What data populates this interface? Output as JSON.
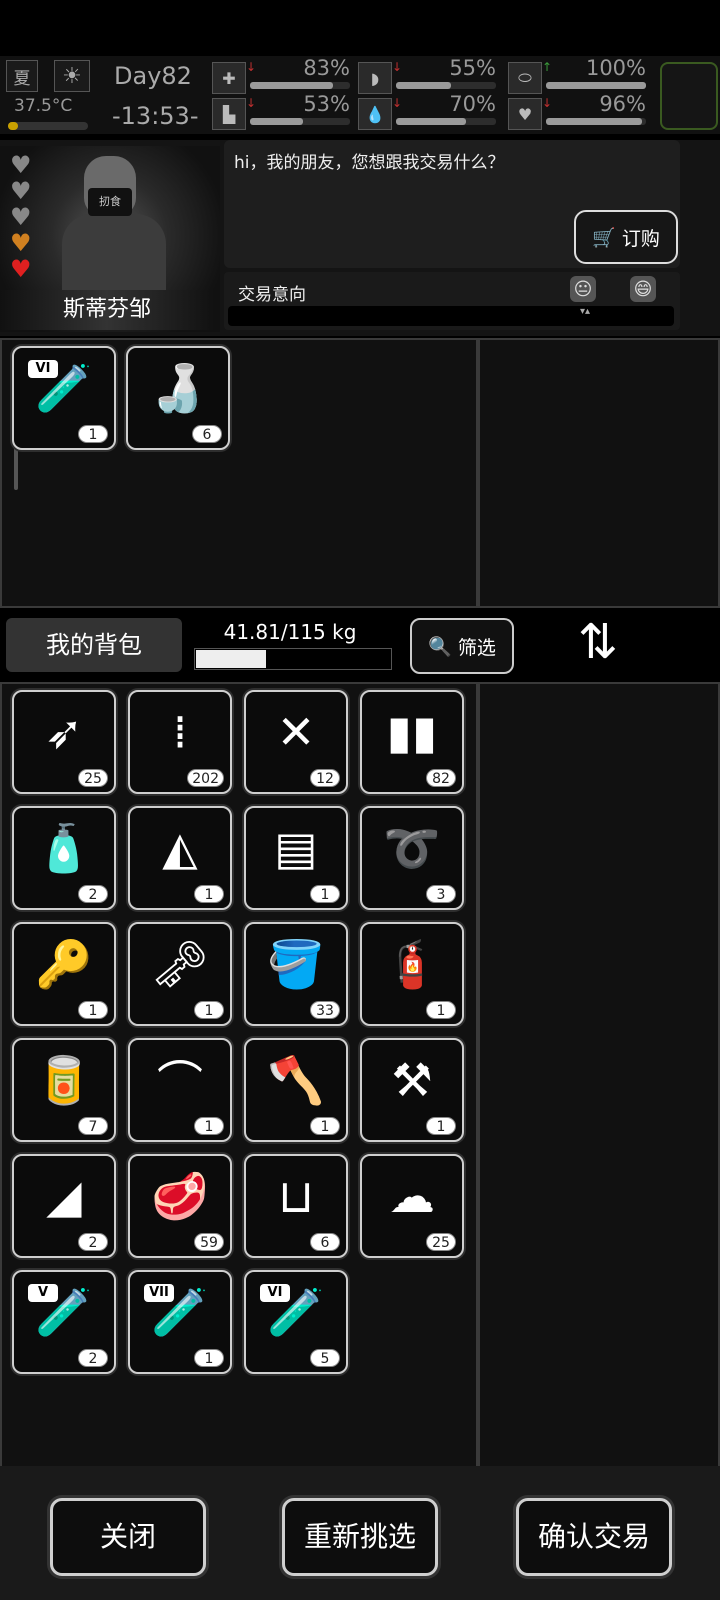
{
  "status": {
    "season": "夏",
    "weather_icon": "sun-icon",
    "temperature": "37.5°C",
    "temperature_level": 0.12,
    "day": "Day82",
    "time": "-13:53-",
    "stats": [
      {
        "icon": "health-kit-icon",
        "value": "83%",
        "level": 0.83,
        "trend": "down"
      },
      {
        "icon": "stomach-icon",
        "value": "55%",
        "level": 0.55,
        "trend": "down"
      },
      {
        "icon": "pill-icon",
        "value": "100%",
        "level": 1.0,
        "trend": "up"
      },
      {
        "icon": "boot-icon",
        "value": "53%",
        "level": 0.53,
        "trend": "down"
      },
      {
        "icon": "water-drop-icon",
        "value": "70%",
        "level": 0.7,
        "trend": "down"
      },
      {
        "icon": "heart-icon",
        "value": "96%",
        "level": 0.96,
        "trend": "down"
      }
    ]
  },
  "npc": {
    "name": "斯蒂芬邹",
    "mask_text": "扨食",
    "hearts_filled": 2,
    "hearts_total": 5,
    "dialog": "hi，我的朋友，您想跟我交易什么？",
    "order_button": "订购",
    "intent_label": "交易意向"
  },
  "trade_items": [
    {
      "icon": "test-tube-icon",
      "glyph": "🧪",
      "count": "1",
      "badge": "VI"
    },
    {
      "icon": "bottles-icon",
      "glyph": "🍶",
      "count": "6"
    }
  ],
  "bag": {
    "tab_label": "我的背包",
    "weight": "41.81/115 kg",
    "weight_fraction": 0.3636,
    "filter_label": "筛选",
    "items": [
      {
        "icon": "arrow-icon",
        "glyph": "➶",
        "count": "25"
      },
      {
        "icon": "rifle-bullets-icon",
        "glyph": "⁞",
        "count": "202"
      },
      {
        "icon": "nails-icon",
        "glyph": "✕",
        "count": "12"
      },
      {
        "icon": "pistol-bullets-icon",
        "glyph": "▮▮",
        "count": "82"
      },
      {
        "icon": "water-bottle-icon",
        "glyph": "🧴",
        "count": "2"
      },
      {
        "icon": "torn-cloth-icon",
        "glyph": "◭",
        "count": "1"
      },
      {
        "icon": "towel-icon",
        "glyph": "▤",
        "count": "1"
      },
      {
        "icon": "rope-icon",
        "glyph": "➰",
        "count": "3"
      },
      {
        "icon": "car-key-icon",
        "glyph": "🔑",
        "count": "1"
      },
      {
        "icon": "key-icon",
        "glyph": "🗝",
        "count": "1"
      },
      {
        "icon": "bucket-icon",
        "glyph": "🪣",
        "count": "33"
      },
      {
        "icon": "thermos-icon",
        "glyph": "🧯",
        "count": "1"
      },
      {
        "icon": "canned-food-icon",
        "glyph": "🥫",
        "count": "7"
      },
      {
        "icon": "crowbar-icon",
        "glyph": "⌒",
        "count": "1"
      },
      {
        "icon": "axe-icon",
        "glyph": "🪓",
        "count": "1"
      },
      {
        "icon": "shovel-icon",
        "glyph": "⚒",
        "count": "1"
      },
      {
        "icon": "cloth-icon",
        "glyph": "◢",
        "count": "2"
      },
      {
        "icon": "meat-icon",
        "glyph": "🥩",
        "count": "59"
      },
      {
        "icon": "beaker-icon",
        "glyph": "⊔",
        "count": "6"
      },
      {
        "icon": "fabric-pile-icon",
        "glyph": "☁",
        "count": "25"
      },
      {
        "icon": "test-tube-icon",
        "glyph": "🧪",
        "count": "2",
        "badge": "V"
      },
      {
        "icon": "test-tube-icon",
        "glyph": "🧪",
        "count": "1",
        "badge": "VII"
      },
      {
        "icon": "test-tube-icon",
        "glyph": "🧪",
        "count": "5",
        "badge": "VI"
      }
    ]
  },
  "buttons": {
    "close": "关闭",
    "reselect": "重新挑选",
    "confirm": "确认交易"
  }
}
